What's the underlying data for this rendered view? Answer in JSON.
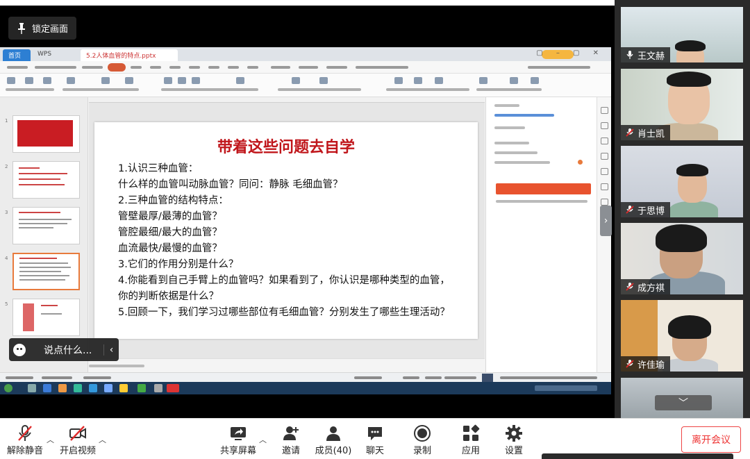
{
  "share": {
    "lock_label": "锁定画面",
    "chat_placeholder": "说点什么...",
    "window": {
      "tabs": {
        "home": "首页",
        "wps": "WPS",
        "file": "5.2人体血管的特点.pptx"
      },
      "slide": {
        "title": "带着这些问题去自学",
        "lines": [
          "1.认识三种血管：",
          "什么样的血管叫动脉血管？同问：静脉  毛细血管？",
          "2.三种血管的结构特点：",
          "管壁最厚/最薄的血管？",
          "管腔最细/最大的血管？",
          "血流最快/最慢的血管？",
          "3.它们的作用分别是什么？",
          "4.你能看到自己手臂上的血管吗？如果看到了，你认识是哪种类型的血管，你的判断依据是什么？",
          "5.回顾一下，我们学习过哪些部位有毛细血管？分别发生了哪些生理活动？"
        ]
      }
    }
  },
  "participants": {
    "scroll_up": "︿",
    "scroll_down": "﹀",
    "items": [
      {
        "name": "王文赫",
        "mic": "on"
      },
      {
        "name": "肖士凯",
        "mic": "muted"
      },
      {
        "name": "于思博",
        "mic": "muted"
      },
      {
        "name": "成方祺",
        "mic": "muted"
      },
      {
        "name": "许佳瑜",
        "mic": "muted"
      }
    ]
  },
  "toolbar": {
    "unmute": "解除静音",
    "start_video": "开启视频",
    "share_screen": "共享屏幕",
    "invite": "邀请",
    "members": "成员(40)",
    "chat": "聊天",
    "record": "录制",
    "apps": "应用",
    "settings": "设置",
    "leave": "离开会议"
  },
  "colors": {
    "slide_title": "#c0161b",
    "leave_border": "#ee4444",
    "mute_red": "#e02b2b",
    "ribbon_accent": "#d65a36"
  }
}
